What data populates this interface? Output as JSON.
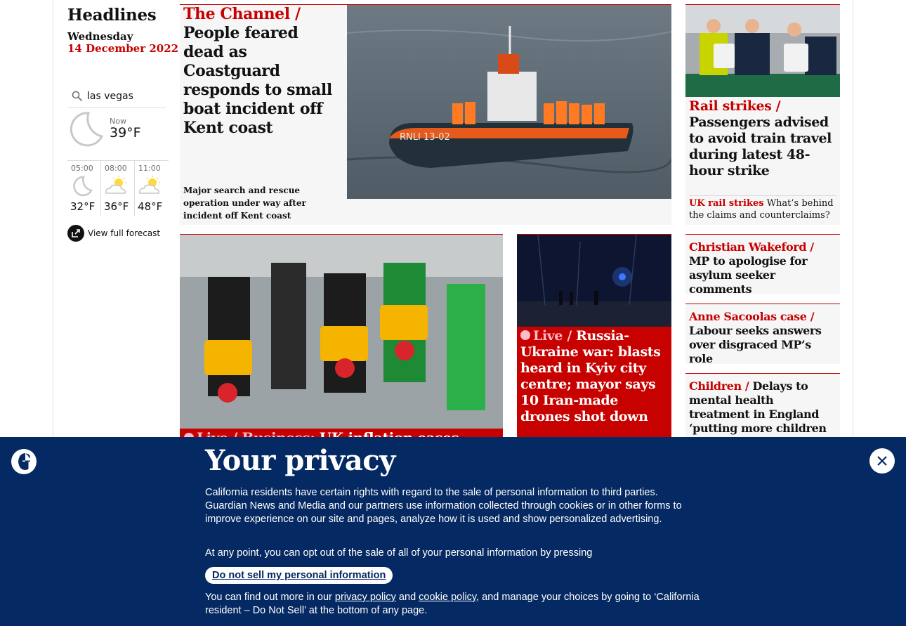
{
  "rail": {
    "title": "Headlines",
    "day": "Wednesday",
    "date": "14 December 2022",
    "weather": {
      "location": "las vegas",
      "now_label": "Now",
      "now_temp": "39°F",
      "now_icon": "moon-icon",
      "forecast": [
        {
          "time": "05:00",
          "temp": "32°F",
          "icon": "moon-icon"
        },
        {
          "time": "08:00",
          "temp": "36°F",
          "icon": "partly-sunny-icon"
        },
        {
          "time": "11:00",
          "temp": "48°F",
          "icon": "partly-sunny-icon"
        }
      ],
      "full_forecast_label": "View full forecast"
    }
  },
  "cards": {
    "channel": {
      "kicker": "The Channel /",
      "headline": "People feared dead as Coastguard responds to small boat incident off Kent coast",
      "standfirst": "Major search and rescue operation under way after incident off Kent coast",
      "boat_text": "RNLI 13-02"
    },
    "fuel": {
      "live": "Live",
      "kicker": "/ Business:",
      "headline": "UK inflation eases"
    },
    "kyiv": {
      "live": "Live",
      "kicker": "/",
      "headline": "Russia-Ukraine war: blasts heard in Kyiv city centre; mayor says 10 Iran-made drones shot down"
    },
    "rail_strikes": {
      "kicker": "Rail strikes /",
      "headline": "Passengers advised to avoid train travel during latest 48-hour strike",
      "sub_kicker": "UK rail strikes",
      "sub_headline": "What’s behind the claims and counterclaims?"
    },
    "wakeford": {
      "kicker": "Christian Wakeford /",
      "headline": "MP to apologise for asylum seeker comments"
    },
    "sacoolas": {
      "kicker": "Anne Sacoolas case /",
      "headline": "Labour seeks answers over disgraced MP’s role"
    },
    "children": {
      "kicker": "Children /",
      "headline": "Delays to mental health treatment in England ‘putting more children in care’"
    }
  },
  "privacy": {
    "title": "Your privacy",
    "paragraph1": "California residents have certain rights with regard to the sale of personal information to third parties. Guardian News and Media and our partners use information collected through cookies or in other forms to improve experience on our site and pages, analyze how it is used and show personalized advertising.",
    "paragraph2": "At any point, you can opt out of the sale of all of your personal information by pressing",
    "button": "Do not sell my personal information",
    "p4_start": "You can find out more in our ",
    "privacy_link": "privacy policy",
    "p4_and": " and ",
    "cookie_link": "cookie policy",
    "p4_end": ", and manage your choices by going to ‘California resident – Do Not Sell’ at the bottom of any page."
  },
  "colors": {
    "news_red": "#c70000",
    "brand_blue": "#052962",
    "card_bg": "#f6f6f6"
  }
}
